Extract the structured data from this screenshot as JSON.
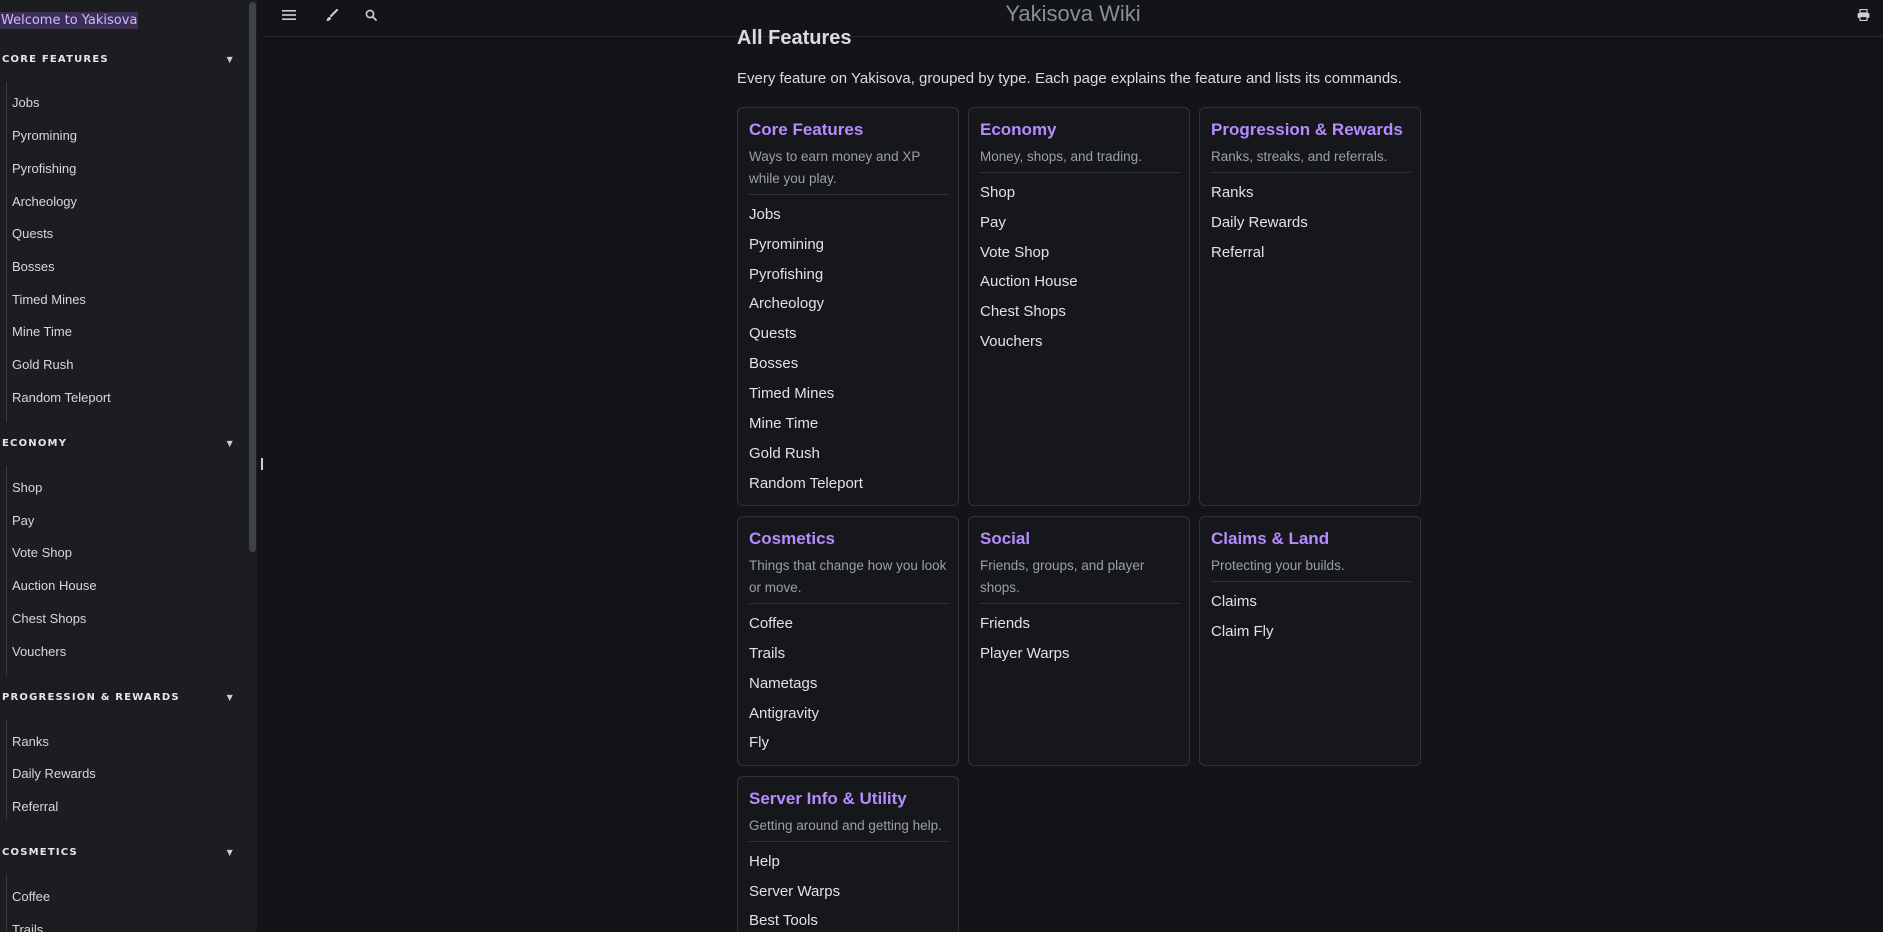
{
  "app": {
    "title": "Yakisova Wiki"
  },
  "toolbar": {
    "menu_icon": "hamburger-icon",
    "theme_icon": "paintbrush-icon",
    "search_icon": "search-icon",
    "print_icon": "printer-icon"
  },
  "sidebar": {
    "welcome": "Welcome to Yakisova",
    "sections": [
      {
        "title": "CORE FEATURES",
        "items": [
          "Jobs",
          "Pyromining",
          "Pyrofishing",
          "Archeology",
          "Quests",
          "Bosses",
          "Timed Mines",
          "Mine Time",
          "Gold Rush",
          "Random Teleport"
        ]
      },
      {
        "title": "ECONOMY",
        "items": [
          "Shop",
          "Pay",
          "Vote Shop",
          "Auction House",
          "Chest Shops",
          "Vouchers"
        ]
      },
      {
        "title": "PROGRESSION & REWARDS",
        "items": [
          "Ranks",
          "Daily Rewards",
          "Referral"
        ]
      },
      {
        "title": "COSMETICS",
        "items": [
          "Coffee",
          "Trails"
        ]
      }
    ]
  },
  "main": {
    "heading": "All Features",
    "intro": "Every feature on Yakisova, grouped by type. Each page explains the feature and lists its commands.",
    "cards": [
      {
        "title": "Core Features",
        "desc": [
          "Ways to earn money and XP",
          "while you play."
        ],
        "items": [
          "Jobs",
          "Pyromining",
          "Pyrofishing",
          "Archeology",
          "Quests",
          "Bosses",
          "Timed Mines",
          "Mine Time",
          "Gold Rush",
          "Random Teleport"
        ]
      },
      {
        "title": "Economy",
        "desc": [
          "Money, shops, and trading."
        ],
        "items": [
          "Shop",
          "Pay",
          "Vote Shop",
          "Auction House",
          "Chest Shops",
          "Vouchers"
        ]
      },
      {
        "title": "Progression & Rewards",
        "desc": [
          "Ranks, streaks, and referrals."
        ],
        "items": [
          "Ranks",
          "Daily Rewards",
          "Referral"
        ]
      },
      {
        "title": "Cosmetics",
        "desc": [
          "Things that change how you look",
          "or move."
        ],
        "items": [
          "Coffee",
          "Trails",
          "Nametags",
          "Antigravity",
          "Fly"
        ]
      },
      {
        "title": "Social",
        "desc": [
          "Friends, groups, and player",
          "shops."
        ],
        "items": [
          "Friends",
          "Player Warps"
        ]
      },
      {
        "title": "Claims & Land",
        "desc": [
          "Protecting your builds."
        ],
        "items": [
          "Claims",
          "Claim Fly"
        ]
      },
      {
        "title": "Server Info & Utility",
        "desc": [
          "Getting around and getting help."
        ],
        "items": [
          "Help",
          "Server Warps",
          "Best Tools"
        ]
      }
    ]
  }
}
